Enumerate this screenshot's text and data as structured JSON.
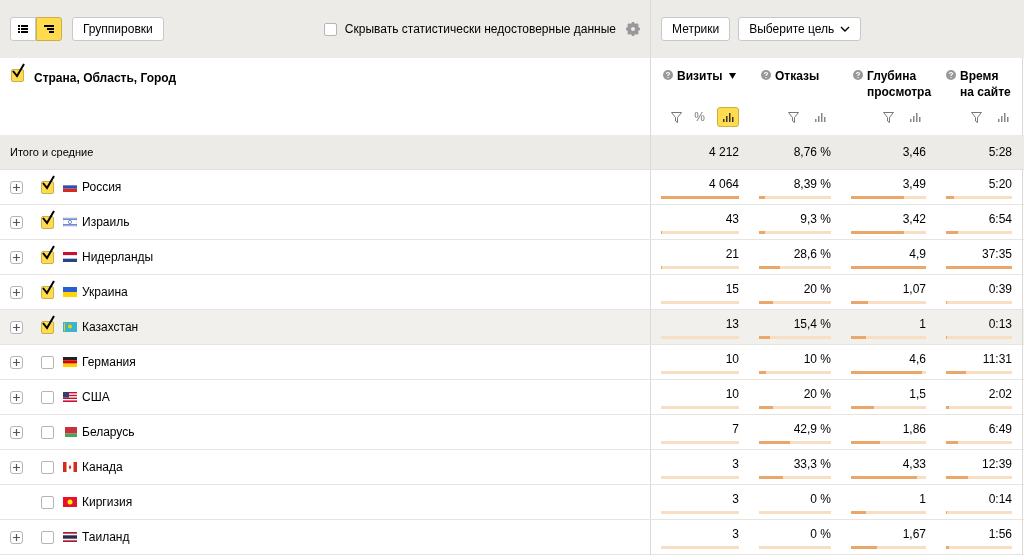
{
  "toolbar": {
    "view_toggles": [
      {
        "selected": false
      },
      {
        "selected": true
      }
    ],
    "groupings_button": "Группировки",
    "hide_unreliable": {
      "label": "Скрывать статистически недостоверные данные",
      "checked": false
    },
    "metrics_button": "Метрики",
    "goal_select": "Выберите цель"
  },
  "dimension_header": {
    "label": "Страна, Область, Город",
    "checked": true
  },
  "columns": [
    {
      "title": "Визиты",
      "sorted": true,
      "percent_label": "%",
      "bars_on": true
    },
    {
      "title": "Отказы",
      "sorted": false,
      "bars_on": false
    },
    {
      "title": "Глубина просмотра",
      "sorted": false,
      "bars_on": false
    },
    {
      "title": "Время на сайте",
      "sorted": false,
      "bars_on": false
    }
  ],
  "totals": {
    "label": "Итого и средние",
    "values": [
      "4 212",
      "8,76 %",
      "3,46",
      "5:28"
    ]
  },
  "rows": [
    {
      "name": "Россия",
      "expandable": true,
      "checked": true,
      "highlighted": false,
      "cells": [
        {
          "value": "4 064",
          "level": 1
        },
        {
          "value": "8,39 %",
          "level": 0.08
        },
        {
          "value": "3,49",
          "level": 0.71
        },
        {
          "value": "5:20",
          "level": 0.12
        }
      ]
    },
    {
      "name": "Израиль",
      "expandable": true,
      "checked": true,
      "highlighted": false,
      "cells": [
        {
          "value": "43",
          "level": 0.01
        },
        {
          "value": "9,3 %",
          "level": 0.09
        },
        {
          "value": "3,42",
          "level": 0.7
        },
        {
          "value": "6:54",
          "level": 0.18
        }
      ]
    },
    {
      "name": "Нидерланды",
      "expandable": true,
      "checked": true,
      "highlighted": false,
      "cells": [
        {
          "value": "21",
          "level": 0.01
        },
        {
          "value": "28,6 %",
          "level": 0.29
        },
        {
          "value": "4,9",
          "level": 1
        },
        {
          "value": "37:35",
          "level": 1
        }
      ]
    },
    {
      "name": "Украина",
      "expandable": true,
      "checked": true,
      "highlighted": false,
      "cells": [
        {
          "value": "15",
          "level": 0
        },
        {
          "value": "20 %",
          "level": 0.2
        },
        {
          "value": "1,07",
          "level": 0.22
        },
        {
          "value": "0:39",
          "level": 0.02
        }
      ]
    },
    {
      "name": "Казахстан",
      "expandable": true,
      "checked": true,
      "highlighted": true,
      "cells": [
        {
          "value": "13",
          "level": 0
        },
        {
          "value": "15,4 %",
          "level": 0.15
        },
        {
          "value": "1",
          "level": 0.2
        },
        {
          "value": "0:13",
          "level": 0.01
        }
      ]
    },
    {
      "name": "Германия",
      "expandable": true,
      "checked": false,
      "highlighted": false,
      "cells": [
        {
          "value": "10",
          "level": 0
        },
        {
          "value": "10 %",
          "level": 0.1
        },
        {
          "value": "4,6",
          "level": 0.94
        },
        {
          "value": "11:31",
          "level": 0.31
        }
      ]
    },
    {
      "name": "США",
      "expandable": true,
      "checked": false,
      "highlighted": false,
      "cells": [
        {
          "value": "10",
          "level": 0
        },
        {
          "value": "20 %",
          "level": 0.2
        },
        {
          "value": "1,5",
          "level": 0.31
        },
        {
          "value": "2:02",
          "level": 0.05
        }
      ]
    },
    {
      "name": "Беларусь",
      "expandable": true,
      "checked": false,
      "highlighted": false,
      "cells": [
        {
          "value": "7",
          "level": 0
        },
        {
          "value": "42,9 %",
          "level": 0.43
        },
        {
          "value": "1,86",
          "level": 0.38
        },
        {
          "value": "6:49",
          "level": 0.18
        }
      ]
    },
    {
      "name": "Канада",
      "expandable": true,
      "checked": false,
      "highlighted": false,
      "cells": [
        {
          "value": "3",
          "level": 0
        },
        {
          "value": "33,3 %",
          "level": 0.33
        },
        {
          "value": "4,33",
          "level": 0.88
        },
        {
          "value": "12:39",
          "level": 0.34
        }
      ]
    },
    {
      "name": "Киргизия",
      "expandable": false,
      "checked": false,
      "highlighted": false,
      "cells": [
        {
          "value": "3",
          "level": 0
        },
        {
          "value": "0 %",
          "level": 0
        },
        {
          "value": "1",
          "level": 0.2
        },
        {
          "value": "0:14",
          "level": 0.01
        }
      ]
    },
    {
      "name": "Таиланд",
      "expandable": true,
      "checked": false,
      "highlighted": false,
      "cells": [
        {
          "value": "3",
          "level": 0
        },
        {
          "value": "0 %",
          "level": 0
        },
        {
          "value": "1,67",
          "level": 0.34
        },
        {
          "value": "1:56",
          "level": 0.05
        }
      ]
    }
  ]
}
